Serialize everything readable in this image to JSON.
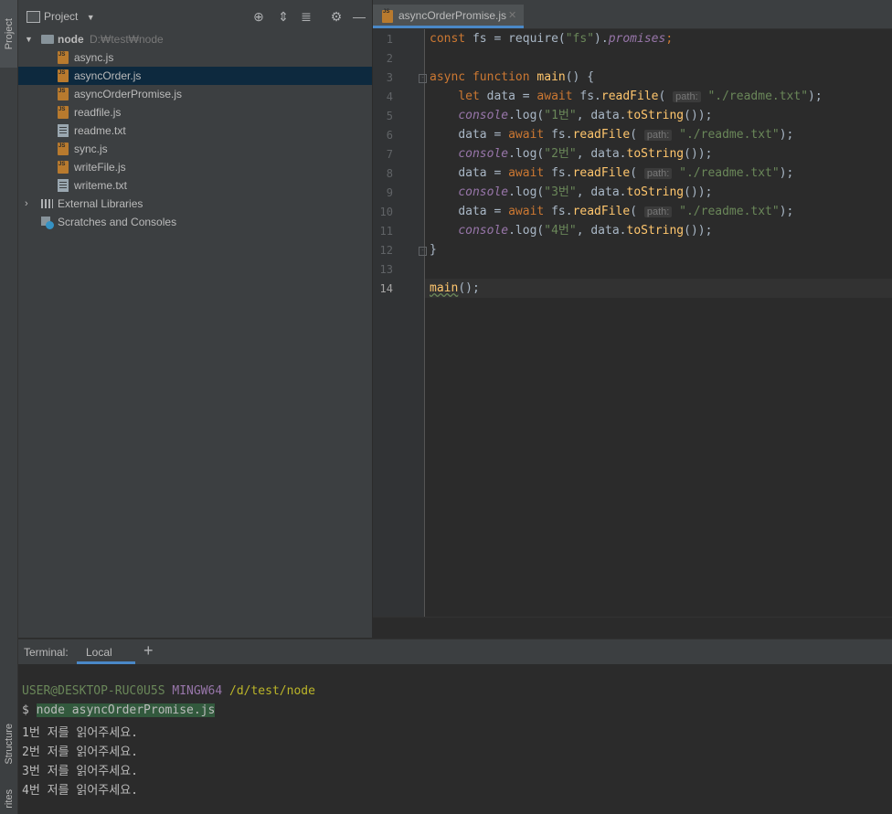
{
  "left_strip": {
    "project_tab": "Project",
    "structure_tab": "Structure",
    "favorites_tab": "rites"
  },
  "project_panel": {
    "title": "Project",
    "root": {
      "name": "node",
      "path": "D:₩test₩node"
    },
    "files": [
      {
        "name": "async.js",
        "type": "js"
      },
      {
        "name": "asyncOrder.js",
        "type": "js",
        "selected": true
      },
      {
        "name": "asyncOrderPromise.js",
        "type": "js"
      },
      {
        "name": "readfile.js",
        "type": "js"
      },
      {
        "name": "readme.txt",
        "type": "txt"
      },
      {
        "name": "sync.js",
        "type": "js"
      },
      {
        "name": "writeFile.js",
        "type": "js"
      },
      {
        "name": "writeme.txt",
        "type": "txt"
      }
    ],
    "external_libraries": "External Libraries",
    "scratches": "Scratches and Consoles"
  },
  "editor": {
    "tab_label": "asyncOrderPromise.js",
    "line_numbers": [
      "1",
      "2",
      "3",
      "4",
      "5",
      "6",
      "7",
      "8",
      "9",
      "10",
      "11",
      "12",
      "13",
      "14"
    ],
    "param_hint": "path:",
    "tokens": {
      "const": "const",
      "fs": " fs = ",
      "require": "require(",
      "fs_str": "\"fs\"",
      "close_dot": ").",
      "promises": "promises",
      "semi": ";",
      "async": "async",
      "function": " function ",
      "main": "main",
      "main_sig": "() {",
      "let": "let",
      "data_eq": " data = ",
      "await": "await",
      "fs_dot": " fs.",
      "readFile": "readFile",
      "open": "( ",
      "readme": "\"./readme.txt\"",
      "end": ");",
      "console": "console",
      "log": ".log(",
      "msg1": "\"1번\"",
      "msg2": "\"2번\"",
      "msg3": "\"3번\"",
      "msg4": "\"4번\"",
      "comma_data": ", data.",
      "toString": "toString",
      "tail": "());",
      "data_assign": "data = ",
      "indent": "    ",
      "close_brace": "}",
      "main_call": "main",
      "call_end": "();"
    }
  },
  "terminal": {
    "label": "Terminal:",
    "tab": "Local",
    "add": "+",
    "prompt_user": "USER@DESKTOP-RUC0U5S",
    "prompt_env": "MINGW64",
    "prompt_path": "/d/test/node",
    "command_prefix": "$ ",
    "command": "node asyncOrderPromise.js",
    "output": [
      "1번 저를 읽어주세요.",
      "2번 저를 읽어주세요.",
      "3번 저를 읽어주세요.",
      "4번 저를 읽어주세요."
    ]
  },
  "colors": {
    "accent": "#4a88c7",
    "keyword": "#cc7832",
    "string": "#6a8759",
    "function": "#ffc66d",
    "property": "#9876aa"
  }
}
